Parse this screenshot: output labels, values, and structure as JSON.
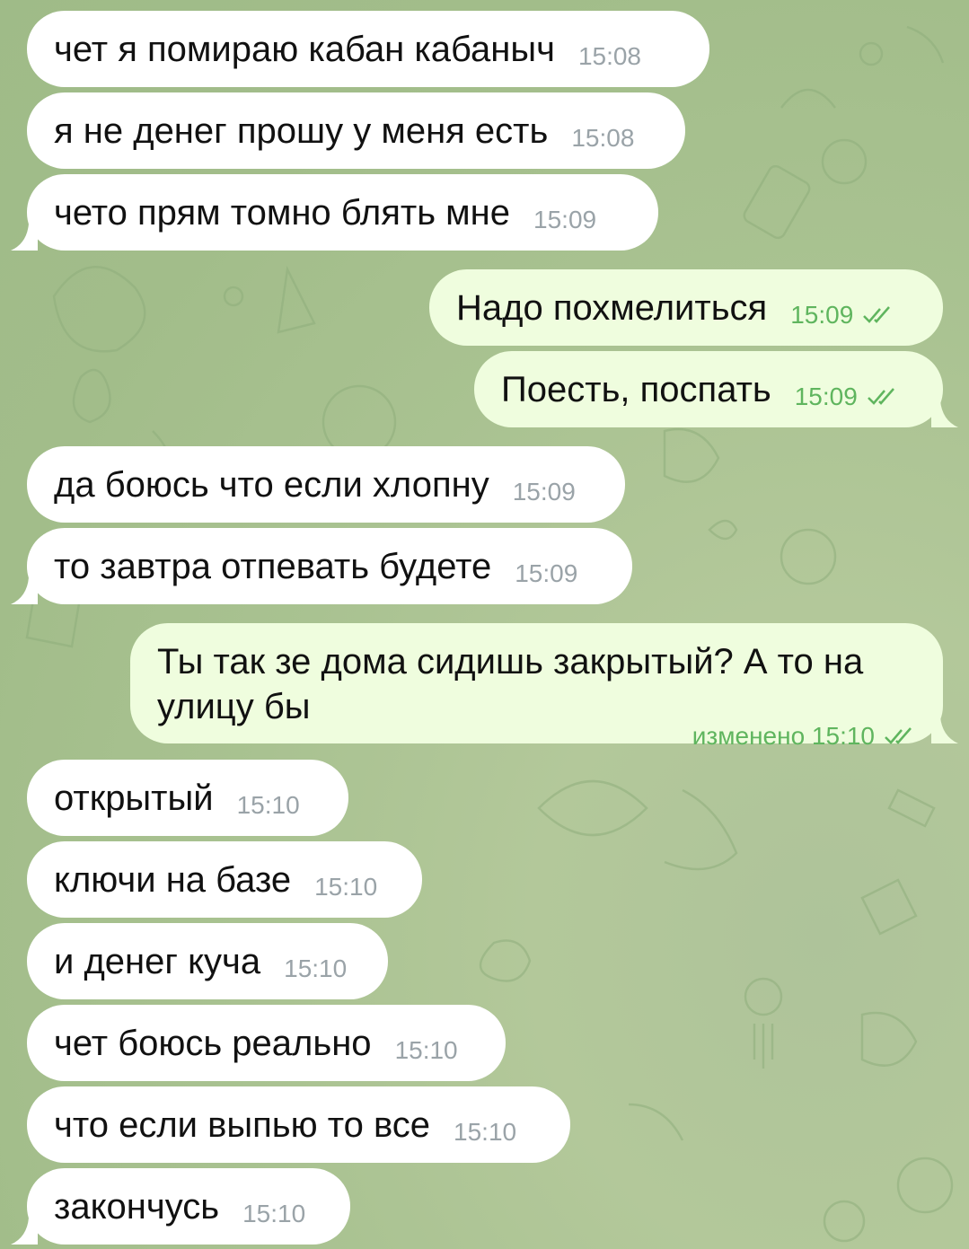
{
  "messages": [
    {
      "dir": "in",
      "text": "чет я помираю кабан кабаныч",
      "time": "15:08"
    },
    {
      "dir": "in",
      "text": "я не денег прошу у меня есть",
      "time": "15:08"
    },
    {
      "dir": "in",
      "text": "чето прям томно блять мне",
      "time": "15:09"
    },
    {
      "dir": "out",
      "text": "Надо похмелиться",
      "time": "15:09"
    },
    {
      "dir": "out",
      "text": "Поесть, поспать",
      "time": "15:09"
    },
    {
      "dir": "in",
      "text": "да боюсь что если хлопну",
      "time": "15:09"
    },
    {
      "dir": "in",
      "text": "то завтра отпевать будете",
      "time": "15:09"
    },
    {
      "dir": "out",
      "text": "Ты так зе дома сидишь закрытый? А то на улицу бы",
      "time": "15:10",
      "edited_label": "изменено"
    },
    {
      "dir": "in",
      "text": "открытый",
      "time": "15:10"
    },
    {
      "dir": "in",
      "text": "ключи на базе",
      "time": "15:10"
    },
    {
      "dir": "in",
      "text": "и денег куча",
      "time": "15:10"
    },
    {
      "dir": "in",
      "text": "чет боюсь реально",
      "time": "15:10"
    },
    {
      "dir": "in",
      "text": "что если выпью то все",
      "time": "15:10"
    },
    {
      "dir": "in",
      "text": "закончусь",
      "time": "15:10"
    }
  ],
  "colors": {
    "incoming_bg": "#ffffff",
    "outgoing_bg": "#effdde",
    "time_in": "#9aa3a8",
    "time_out": "#5fb55e",
    "wallpaper": "#a9c291"
  },
  "icons": {
    "read_status": "double-check-icon"
  }
}
